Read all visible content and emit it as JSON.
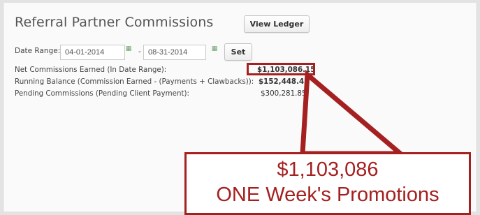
{
  "header": {
    "title": "Referral Partner Commissions",
    "view_ledger_label": "View Ledger"
  },
  "date_range": {
    "label": "Date Range:",
    "start": "04-01-2014",
    "end": "08-31-2014",
    "separator": "-",
    "set_label": "Set"
  },
  "summary": [
    {
      "label": "Net Commissions Earned (In Date Range):",
      "value": "$1,103,086.15"
    },
    {
      "label": "Running Balance (Commission Earned - (Payments + Clawbacks)):",
      "value": "$152,448.45"
    },
    {
      "label": "Pending Commissions (Pending Client Payment):",
      "value": "$300,281.85"
    }
  ],
  "callout": {
    "amount": "$1,103,086",
    "caption": "ONE Week's Promotions"
  },
  "colors": {
    "accent": "#a52020",
    "background": "#e3e3e3",
    "panel": "#fafafa"
  }
}
